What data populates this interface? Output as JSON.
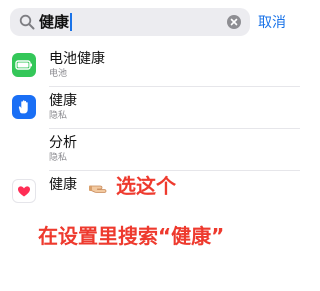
{
  "search": {
    "query": "健康",
    "cancel_label": "取消"
  },
  "results": [
    {
      "title": "电池健康",
      "subtitle": "电池",
      "icon": "battery-icon",
      "color": "#34c759"
    },
    {
      "title": "健康",
      "subtitle": "隐私",
      "icon": "hand-icon",
      "color": "#1a6ff5"
    },
    {
      "title": "分析",
      "subtitle": "隐私",
      "icon": "",
      "color": ""
    },
    {
      "title": "健康",
      "subtitle": "",
      "icon": "heart-icon",
      "color": "#ff2d55"
    }
  ],
  "annotations": {
    "pick_this": "选这个",
    "instruction": "在设置里搜索“健康”",
    "hand_icon": "pointing-hand-icon"
  },
  "colors": {
    "accent": "#1a73e8",
    "annotation_red": "#ee3a2e"
  }
}
